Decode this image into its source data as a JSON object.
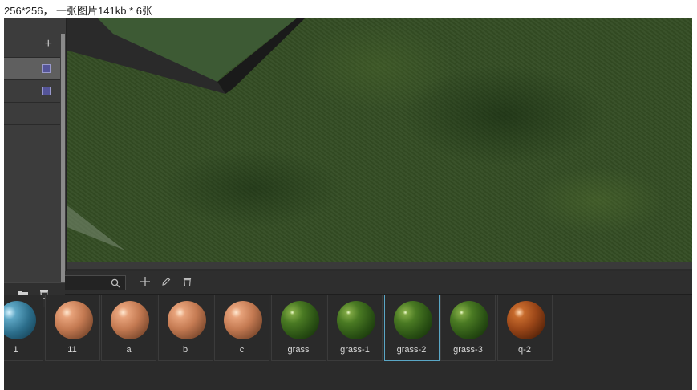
{
  "caption": "256*256， 一张图片141kb * 6张",
  "left_panel": {
    "add_label": "+"
  },
  "materials": [
    {
      "name": "1",
      "style": "teal"
    },
    {
      "name": "11",
      "style": "skin"
    },
    {
      "name": "a",
      "style": "skin"
    },
    {
      "name": "b",
      "style": "skin"
    },
    {
      "name": "c",
      "style": "skin"
    },
    {
      "name": "grass",
      "style": "green"
    },
    {
      "name": "grass-1",
      "style": "green"
    },
    {
      "name": "grass-2",
      "style": "green",
      "selected": true
    },
    {
      "name": "grass-3",
      "style": "green"
    },
    {
      "name": "q-2",
      "style": "rust"
    }
  ],
  "icons": {
    "search": "search-icon",
    "add": "plus-icon",
    "edit": "pencil-icon",
    "delete": "trash-icon",
    "folder": "folder-icon"
  }
}
